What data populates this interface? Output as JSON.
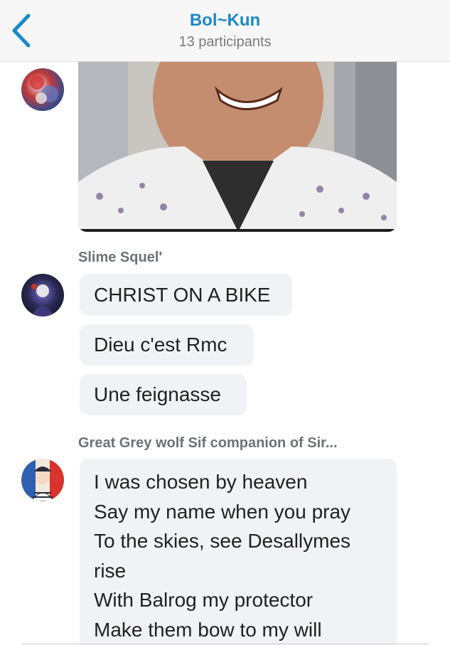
{
  "header": {
    "title": "Bol~Kun",
    "participants": "13 participants"
  },
  "messages": {
    "slime": {
      "sender": "Slime Squel'",
      "bubbles": [
        "CHRIST ON A BIKE",
        "Dieu c'est Rmc",
        "Une feignasse"
      ]
    },
    "wolf": {
      "sender": "Great Grey wolf Sif companion of Sir...",
      "lines": [
        "I was chosen by heaven",
        "Say my name when you pray",
        "To the skies, see Desallymes",
        "rise",
        "With Balrog my protector",
        "Make them bow to my will"
      ]
    }
  },
  "colors": {
    "accent": "#1a88c7",
    "bubble": "#f0f2f6",
    "sender": "#6d7178"
  },
  "icons": {
    "back": "chevron-left-icon"
  }
}
